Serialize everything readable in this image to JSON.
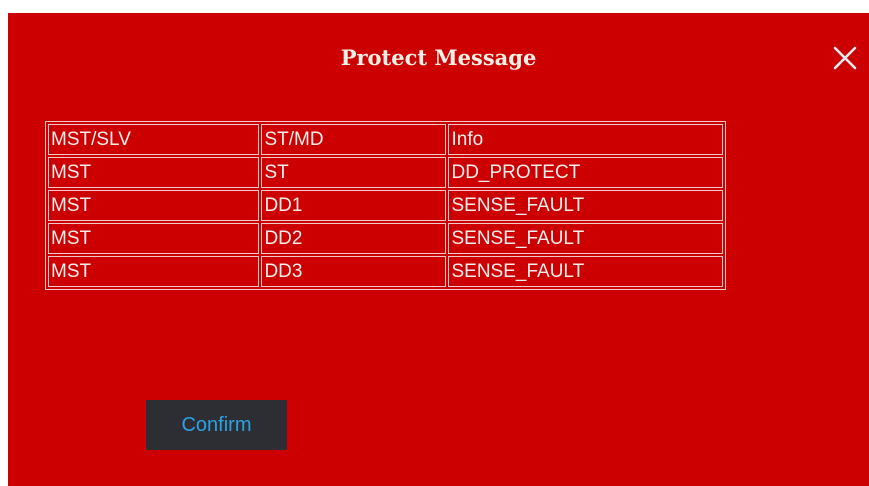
{
  "dialog": {
    "title": "Protect Message",
    "close_icon": "close-icon",
    "confirm_label": "Confirm"
  },
  "table": {
    "headers": [
      "MST/SLV",
      "ST/MD",
      "Info"
    ],
    "rows": [
      [
        "MST",
        "ST",
        "DD_PROTECT"
      ],
      [
        "MST",
        "DD1",
        "SENSE_FAULT"
      ],
      [
        "MST",
        "DD2",
        "SENSE_FAULT"
      ],
      [
        "MST",
        "DD3",
        "SENSE_FAULT"
      ]
    ]
  },
  "colors": {
    "dialog_background": "#cc0000",
    "table_border": "#efc8c8",
    "text": "#f7eeee",
    "button_background": "#2d2e34",
    "button_text": "#29a3e6"
  }
}
